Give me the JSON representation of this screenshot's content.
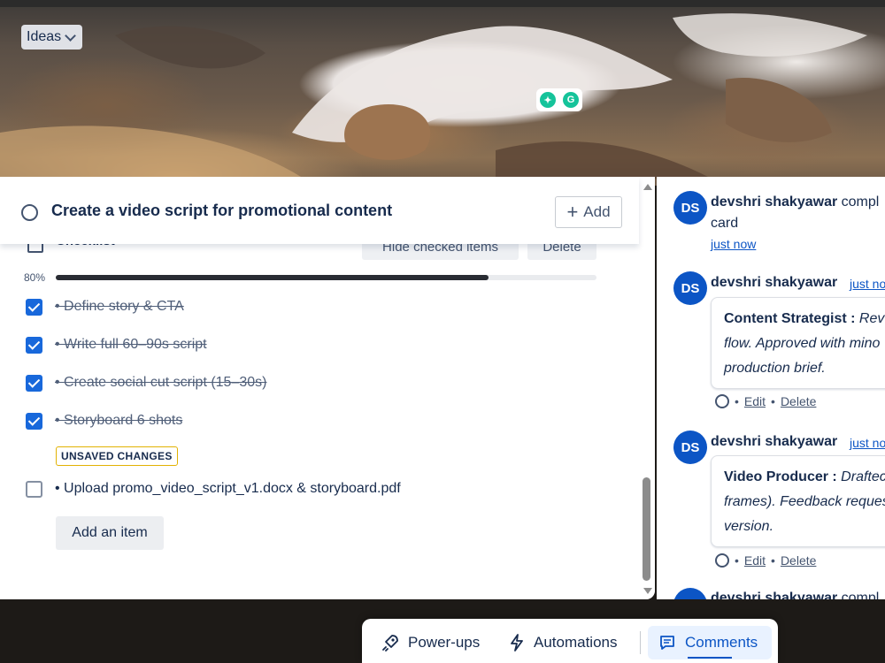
{
  "cover": {
    "list_chip": "Ideas"
  },
  "card": {
    "title": "Create a video script for promotional content",
    "add_button": "Add"
  },
  "checklist": {
    "title": "Checklist",
    "hide_checked_label": "Hide checked items",
    "delete_label": "Delete",
    "progress_label": "80%",
    "progress_fraction": 0.8,
    "items": [
      {
        "text": "• Define story & CTA",
        "checked": true
      },
      {
        "text": "• Write full 60–90s script",
        "checked": true
      },
      {
        "text": "• Create social cut script (15–30s)",
        "checked": true
      },
      {
        "text": "• Storyboard 6 shots",
        "checked": true
      },
      {
        "text": "• Upload promo_video_script_v1.docx & storyboard.pdf",
        "checked": false
      }
    ],
    "unsaved_badge": "UNSAVED CHANGES",
    "add_item_label": "Add an item"
  },
  "activity": {
    "entries": [
      {
        "avatar": "DS",
        "author": "devshri shakyawar",
        "action": " compl",
        "action_line2": "card",
        "time": "just now"
      },
      {
        "avatar": "DS",
        "author": "devshri shakyawar",
        "time": "just no",
        "role": "Content Strategist :",
        "body_line1": " Rev",
        "body_line2": "flow. Approved with mino",
        "body_line3": "production brief.",
        "edit": "Edit",
        "delete": "Delete"
      },
      {
        "avatar": "DS",
        "author": "devshri shakyawar",
        "time": "just no",
        "role": "Video Producer :",
        "body_line1": " Draftec",
        "body_line2": "frames). Feedback request",
        "body_line3": "version.",
        "edit": "Edit",
        "delete": "Delete"
      },
      {
        "avatar": "DS",
        "author": "devshri shakyawar",
        "action": " compl"
      }
    ]
  },
  "bottom_bar": {
    "powerups": "Power-ups",
    "automations": "Automations",
    "comments": "Comments"
  },
  "colors": {
    "accent": "#1868db",
    "avatar": "#0c55c5",
    "unsaved_border": "#e2b203",
    "progress": "#292c33"
  }
}
